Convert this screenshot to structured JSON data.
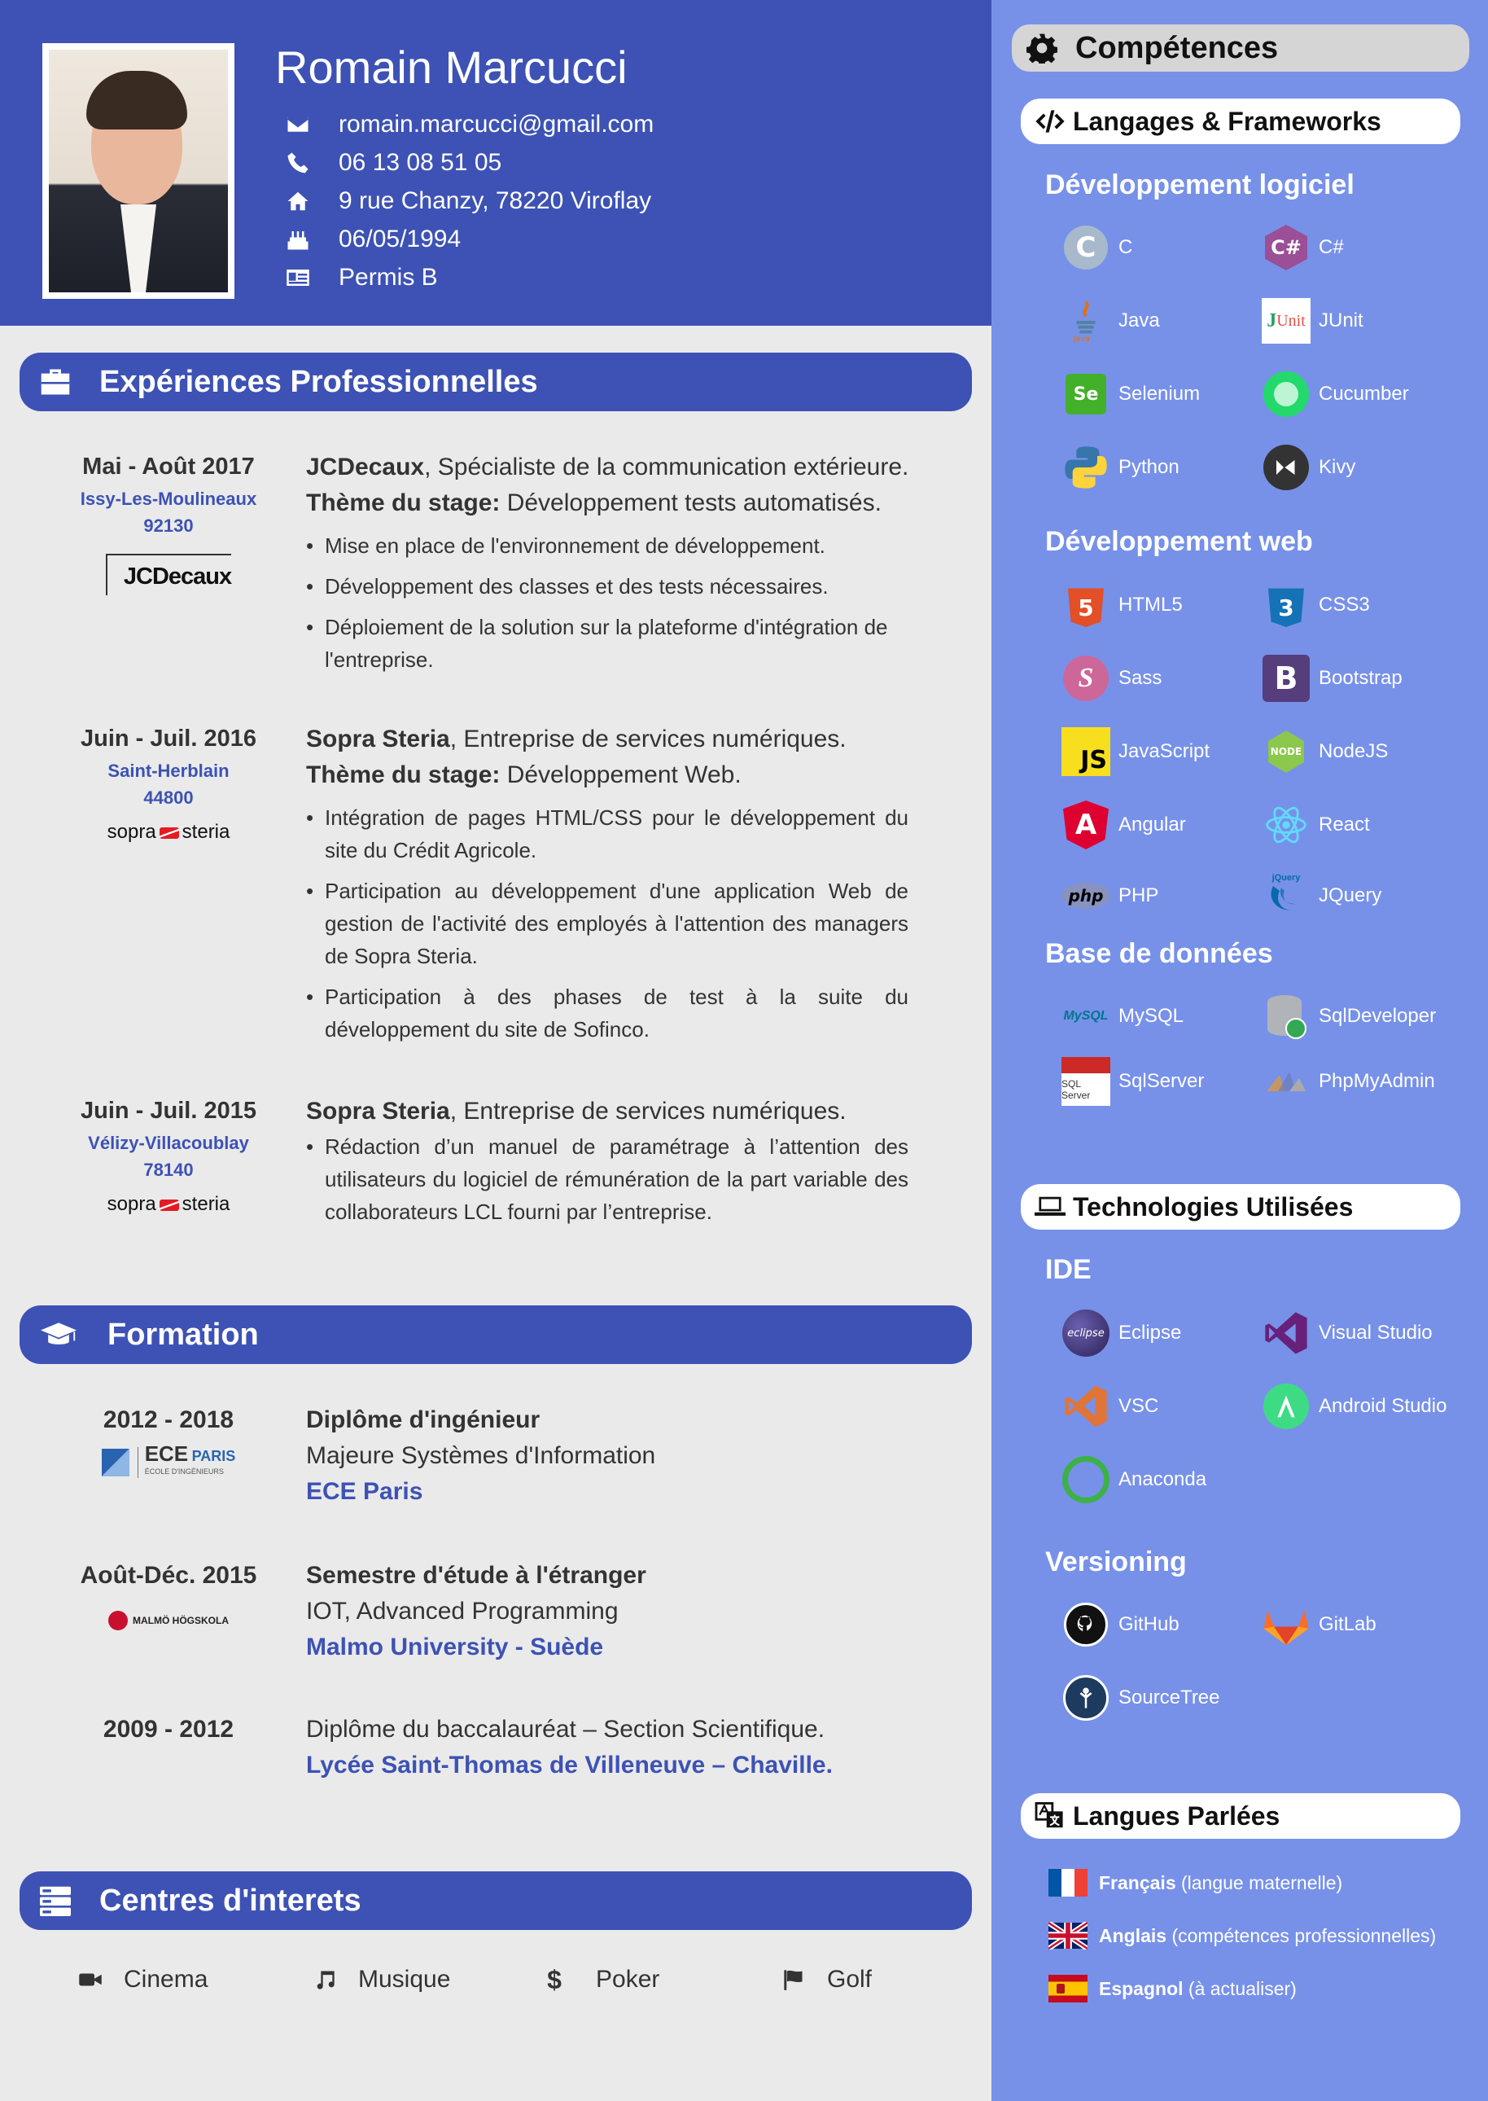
{
  "profile": {
    "name": "Romain Marcucci",
    "email": "romain.marcucci@gmail.com",
    "phone": "06 13 08 51 05",
    "address": "9 rue Chanzy, 78220 Viroflay",
    "birthdate": "06/05/1994",
    "license": "Permis B"
  },
  "sections": {
    "experience": "Expériences Professionnelles",
    "education": "Formation",
    "interests": "Centres d'interets",
    "skills": "Compétences"
  },
  "experiences": [
    {
      "date": "Mai - Août 2017",
      "location": "Issy-Les-Moulineaux",
      "postcode": "92130",
      "logo_text": "JCDecaux",
      "company": "JCDecaux",
      "company_desc": ", Spécialiste de la communication extérieure.",
      "theme_label": "Thème du stage:",
      "theme": " Développement tests automatisés.",
      "bullets": [
        "Mise en place de l'environnement de développement.",
        "Développement des classes et des tests nécessaires.",
        "Déploiement de la solution sur la plateforme d'intégration de l'entreprise."
      ]
    },
    {
      "date": "Juin - Juil. 2016",
      "location": "Saint-Herblain",
      "postcode": "44800",
      "logo_text_a": "sopra",
      "logo_text_b": "steria",
      "company": "Sopra Steria",
      "company_desc": ", Entreprise de services numériques.",
      "theme_label": "Thème du stage:",
      "theme": " Développement Web.",
      "bullets": [
        "Intégration de pages HTML/CSS pour le développement du site du Crédit Agricole.",
        "Participation au développement d'une application Web de gestion de l'activité des employés à l'attention des managers de Sopra Steria.",
        "Participation à des phases de test à la suite du développement du site de Sofinco."
      ]
    },
    {
      "date": "Juin - Juil. 2015",
      "location": "Vélizy-Villacoublay",
      "postcode": "78140",
      "logo_text_a": "sopra",
      "logo_text_b": "steria",
      "company": "Sopra Steria",
      "company_desc": ", Entreprise de services numériques.",
      "bullets": [
        "Rédaction d’un manuel de paramétrage à l’attention des utilisateurs du logiciel de rémunération de la part variable des collaborateurs LCL fourni par l’entreprise."
      ]
    }
  ],
  "education": [
    {
      "date": "2012 - 2018",
      "title": "Diplôme d'ingénieur",
      "subtitle": "Majeure Systèmes d'Information",
      "school": "ECE Paris",
      "logo_a": "ECE",
      "logo_b": "PARIS",
      "logo_c": "ÉCOLE D'INGÉNIEURS"
    },
    {
      "date": "Août-Déc. 2015",
      "title": "Semestre d'étude à l'étranger",
      "subtitle": "IOT, Advanced Programming",
      "school": "Malmo University - Suède",
      "logo_a": "MALMÖ HÖGSKOLA"
    },
    {
      "date": "2009 - 2012",
      "title": "Diplôme du baccalauréat – Section Scientifique.",
      "school": "Lycée Saint-Thomas de Villeneuve – Chaville."
    }
  ],
  "interests": [
    "Cinema",
    "Musique",
    "Poker",
    "Golf"
  ],
  "skills_groups": {
    "lang_frameworks": "Langages & Frameworks",
    "technologies": "Technologies Utilisées",
    "languages_spoken": "Langues Parlées"
  },
  "categories": {
    "software": "Développement logiciel",
    "web": "Développement web",
    "db": "Base de données",
    "ide": "IDE",
    "versioning": "Versioning"
  },
  "skills": {
    "software": [
      "C",
      "C#",
      "Java",
      "JUnit",
      "Selenium",
      "Cucumber",
      "Python",
      "Kivy"
    ],
    "web": [
      "HTML5",
      "CSS3",
      "Sass",
      "Bootstrap",
      "JavaScript",
      "NodeJS",
      "Angular",
      "React",
      "PHP",
      "JQuery"
    ],
    "db": [
      "MySQL",
      "SqlDeveloper",
      "SqlServer",
      "PhpMyAdmin"
    ],
    "ide": [
      "Eclipse",
      "Visual Studio",
      "VSC",
      "Android Studio",
      "Anaconda"
    ],
    "versioning": [
      "GitHub",
      "GitLab",
      "SourceTree"
    ]
  },
  "logo_texts": {
    "html": "HTML",
    "css": "CSS",
    "js": "JS",
    "node": "NODE",
    "php": "php",
    "jquery": "jQuery",
    "mysql": "MySQL",
    "sqlserver": "SQL Server",
    "eclipse": "eclipse",
    "junit_a": "J",
    "junit_b": "Unit"
  },
  "spoken": [
    {
      "lang": "Français",
      "level": " (langue maternelle)"
    },
    {
      "lang": "Anglais",
      "level": " (compétences professionnelles)"
    },
    {
      "lang": "Espagnol",
      "level": " (à actualiser)"
    }
  ],
  "colors": {
    "primary": "#3d52b4",
    "sidebar": "#7791e9",
    "background": "#eaeaea"
  }
}
